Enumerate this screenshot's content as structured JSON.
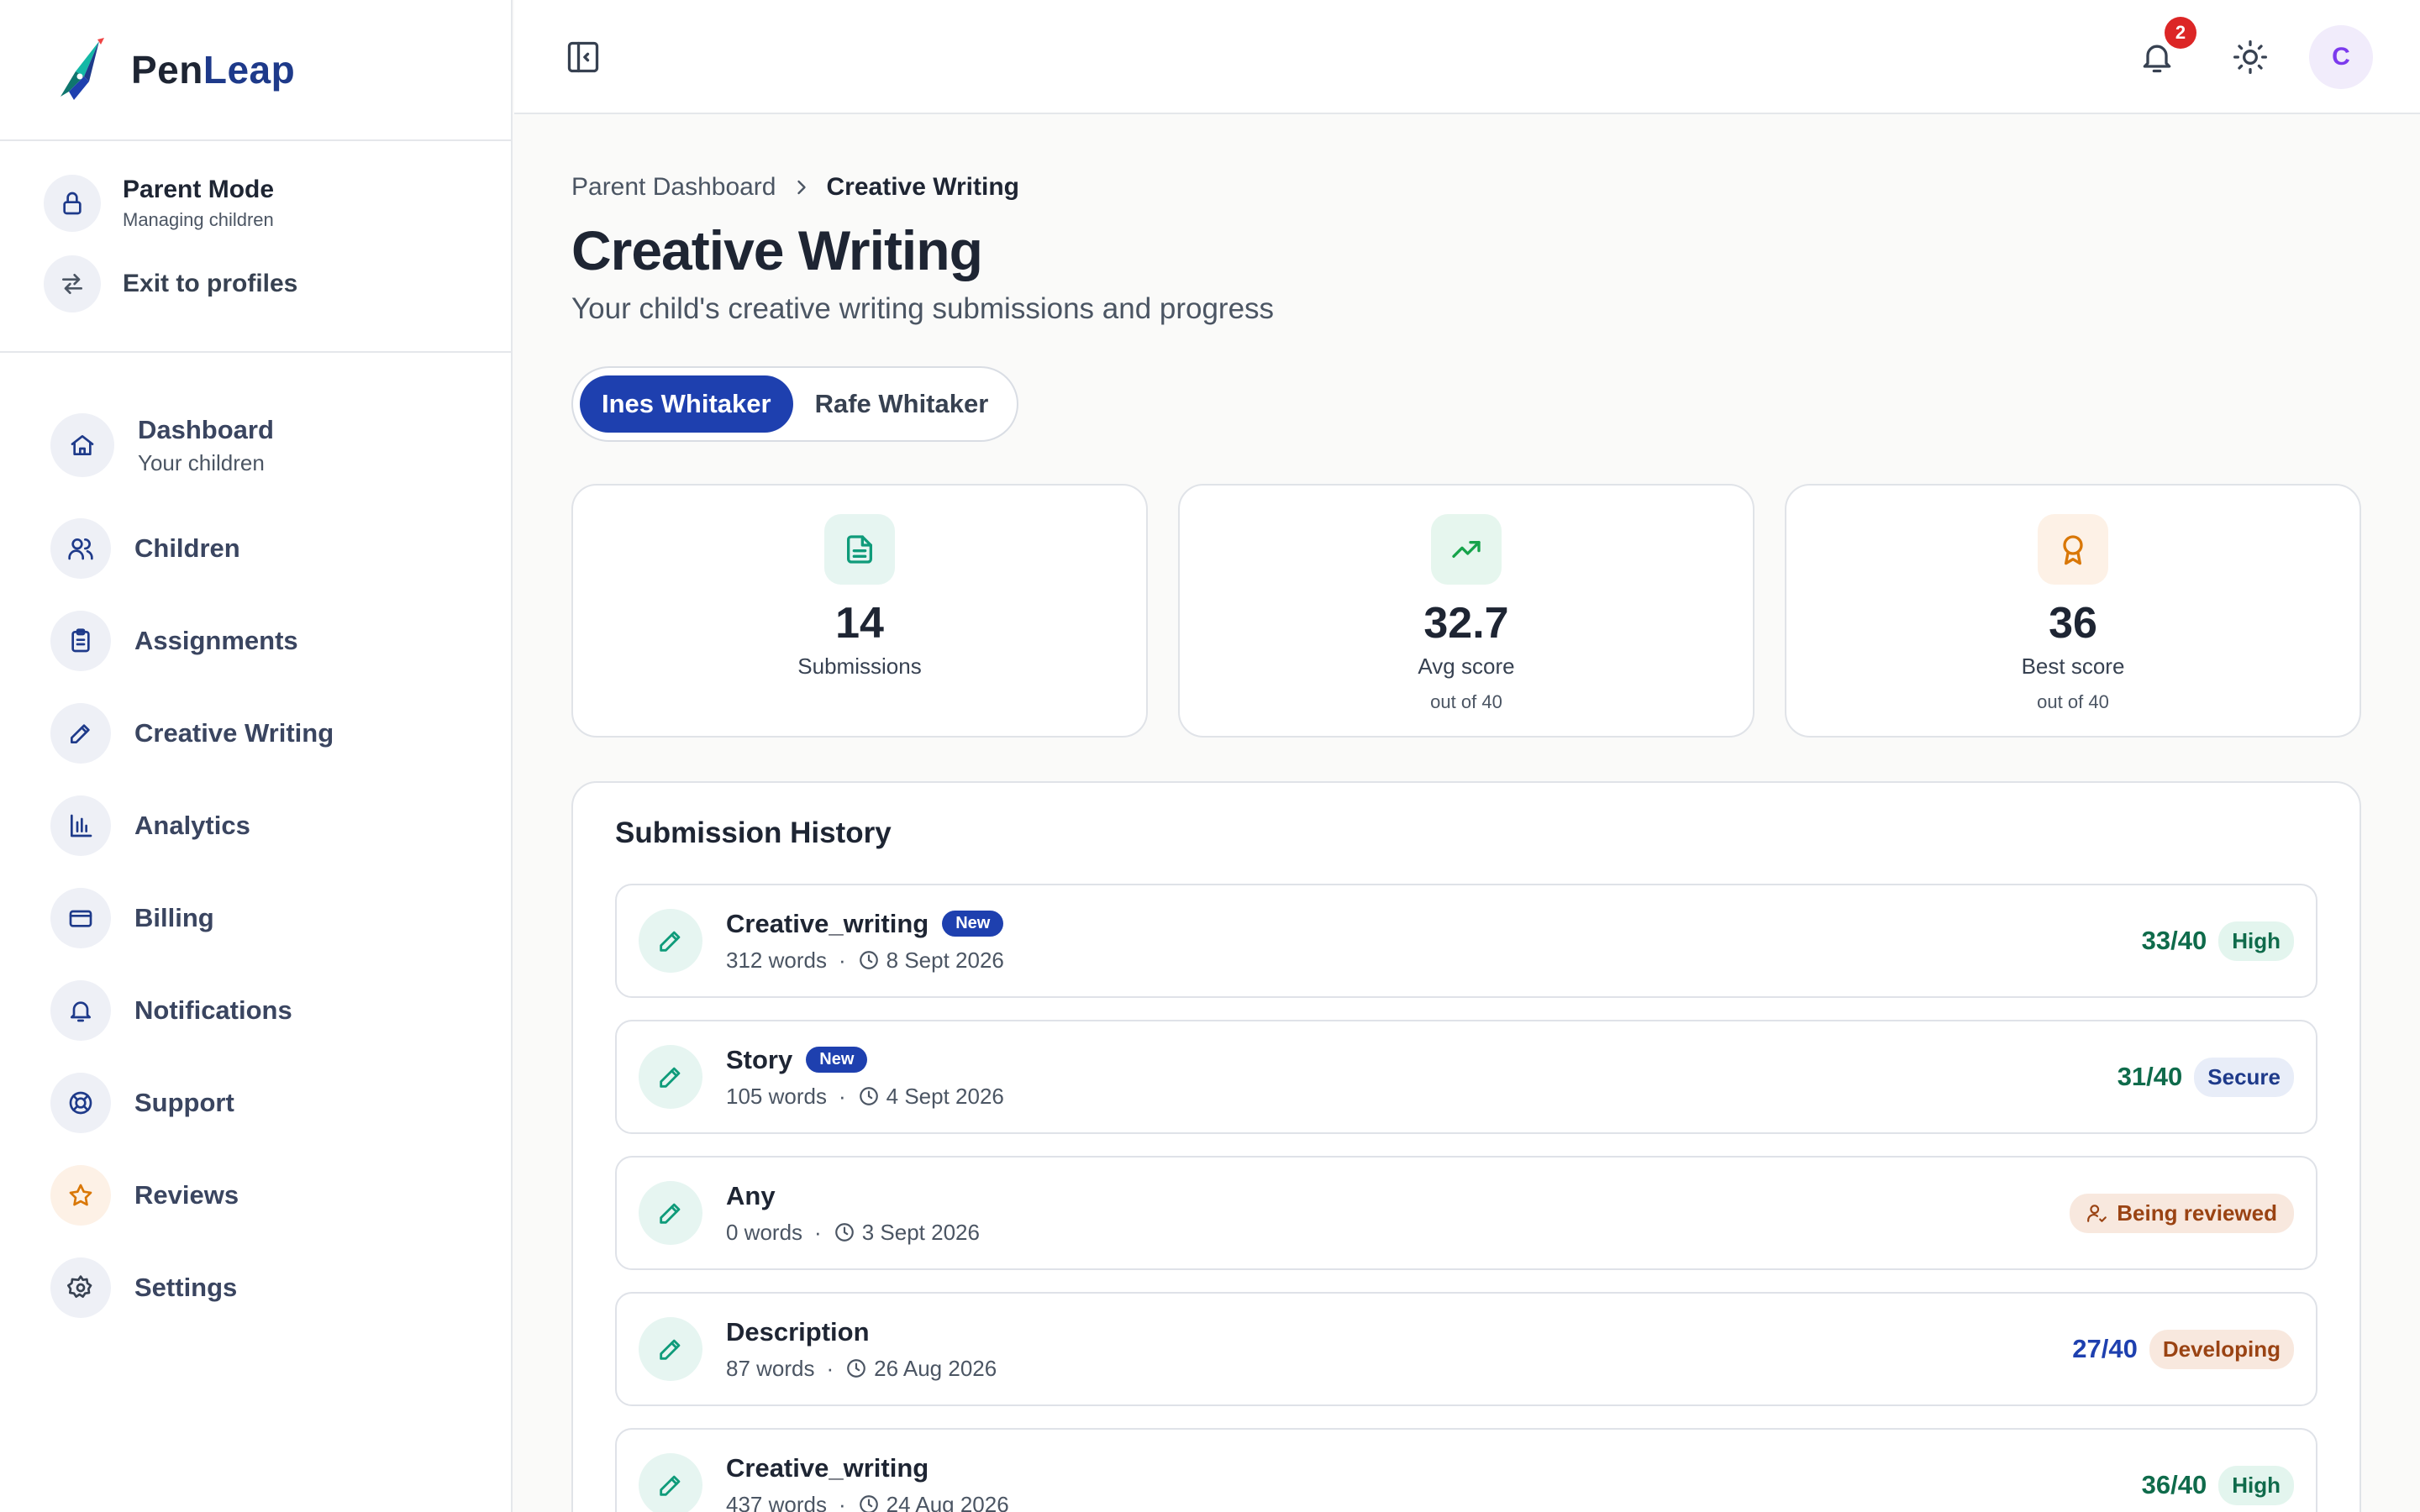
{
  "brand": {
    "name_part1": "Pen",
    "name_part2": "Leap"
  },
  "mode": {
    "title": "Parent Mode",
    "subtitle": "Managing children",
    "exit_label": "Exit to profiles"
  },
  "nav": {
    "dashboard_label": "Dashboard",
    "dashboard_sub": "Your children",
    "items": [
      {
        "label": "Children",
        "icon": "users-icon"
      },
      {
        "label": "Assignments",
        "icon": "clipboard-icon"
      },
      {
        "label": "Creative Writing",
        "icon": "pen-icon"
      },
      {
        "label": "Analytics",
        "icon": "bar-chart-icon"
      },
      {
        "label": "Billing",
        "icon": "credit-card-icon"
      },
      {
        "label": "Notifications",
        "icon": "bell-icon"
      },
      {
        "label": "Support",
        "icon": "life-buoy-icon"
      },
      {
        "label": "Reviews",
        "icon": "star-icon"
      },
      {
        "label": "Settings",
        "icon": "gear-icon"
      }
    ]
  },
  "topbar": {
    "notification_count": "2",
    "avatar_initial": "C"
  },
  "breadcrumb": {
    "parent": "Parent Dashboard",
    "current": "Creative Writing"
  },
  "page": {
    "title": "Creative Writing",
    "subtitle": "Your child's creative writing submissions and progress"
  },
  "children_tabs": [
    {
      "label": "Ines Whitaker",
      "selected": true
    },
    {
      "label": "Rafe Whitaker",
      "selected": false
    }
  ],
  "stats": [
    {
      "value": "14",
      "label": "Submissions",
      "sub": ""
    },
    {
      "value": "32.7",
      "label": "Avg score",
      "sub": "out of 40"
    },
    {
      "value": "36",
      "label": "Best score",
      "sub": "out of 40"
    }
  ],
  "history": {
    "title": "Submission History",
    "new_label": "New",
    "rows": [
      {
        "title": "Creative_writing",
        "is_new": true,
        "words": "312 words",
        "date": "8 Sept 2026",
        "score": "33/40",
        "status": "High"
      },
      {
        "title": "Story",
        "is_new": true,
        "words": "105 words",
        "date": "4 Sept 2026",
        "score": "31/40",
        "status": "Secure"
      },
      {
        "title": "Any",
        "is_new": false,
        "words": "0 words",
        "date": "3 Sept 2026",
        "score": "",
        "status": "Being reviewed"
      },
      {
        "title": "Description",
        "is_new": false,
        "words": "87 words",
        "date": "26 Aug 2026",
        "score": "27/40",
        "status": "Developing"
      },
      {
        "title": "Creative_writing",
        "is_new": false,
        "words": "437 words",
        "date": "24 Aug 2026",
        "score": "36/40",
        "status": "High"
      }
    ]
  },
  "colors": {
    "primary": "#1e40af",
    "brand_dark": "#1e3a8a",
    "teal": "#0f9b7a",
    "badge_red": "#dc2626",
    "avatar_purple": "#7c3aed"
  }
}
